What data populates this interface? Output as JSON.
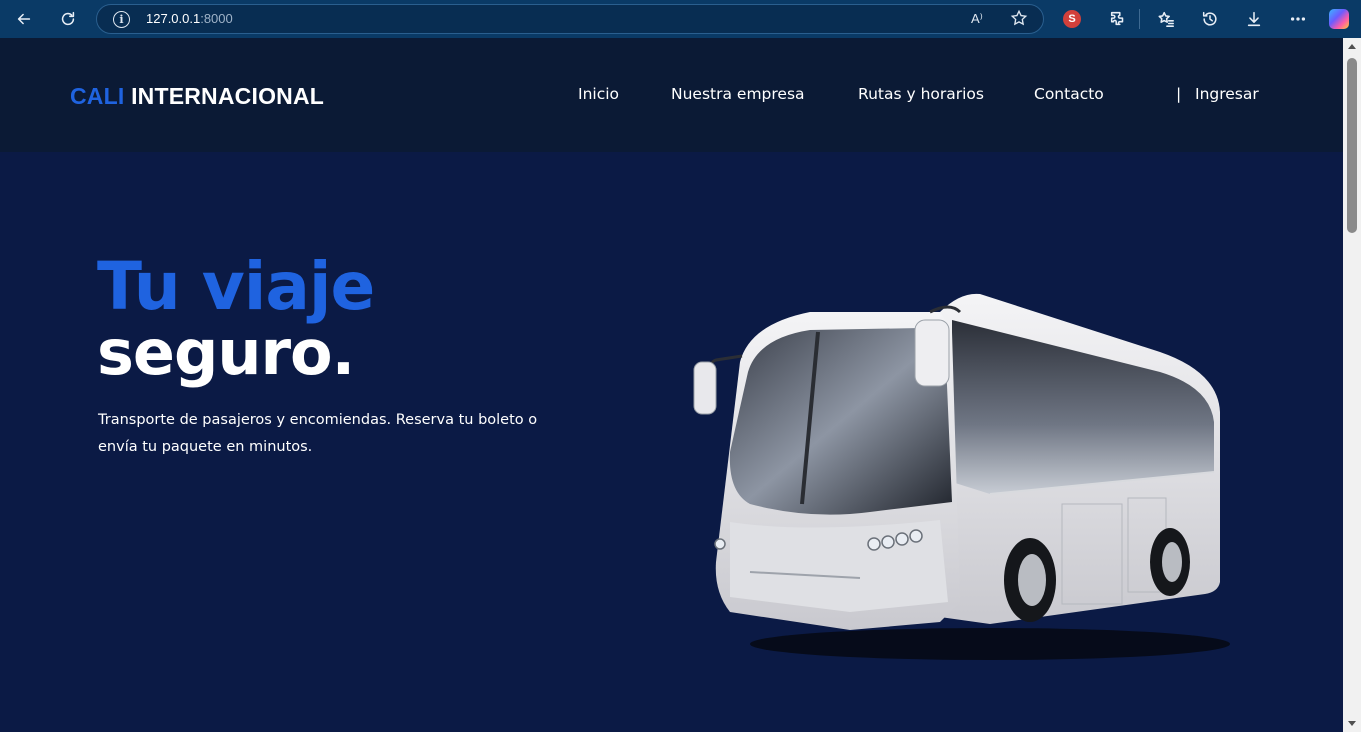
{
  "browser": {
    "url_host": "127.0.0.1",
    "url_port": ":8000",
    "read_aloud_label": "A⁾",
    "extension_badge": "S",
    "colors": {
      "chrome": "#0a3a66",
      "address_bar": "#082d52"
    }
  },
  "site": {
    "logo": {
      "part1": "CALI",
      "part2": "INTERNACIONAL"
    },
    "nav": {
      "items": [
        {
          "label": "Inicio"
        },
        {
          "label": "Nuestra empresa"
        },
        {
          "label": "Rutas y horarios"
        },
        {
          "label": "Contacto"
        }
      ],
      "divider": "|",
      "login": "Ingresar"
    },
    "hero": {
      "title_line1": "Tu viaje",
      "title_line2": "seguro.",
      "subtitle": "Transporte de pasajeros y encomiendas. Reserva tu boleto o envía tu paquete en minutos.",
      "image": "white-coach-bus"
    },
    "colors": {
      "accent": "#1f63e0",
      "nav_bg": "#0b1a35",
      "hero_bg": "#0b1a45",
      "text": "#ffffff"
    }
  }
}
